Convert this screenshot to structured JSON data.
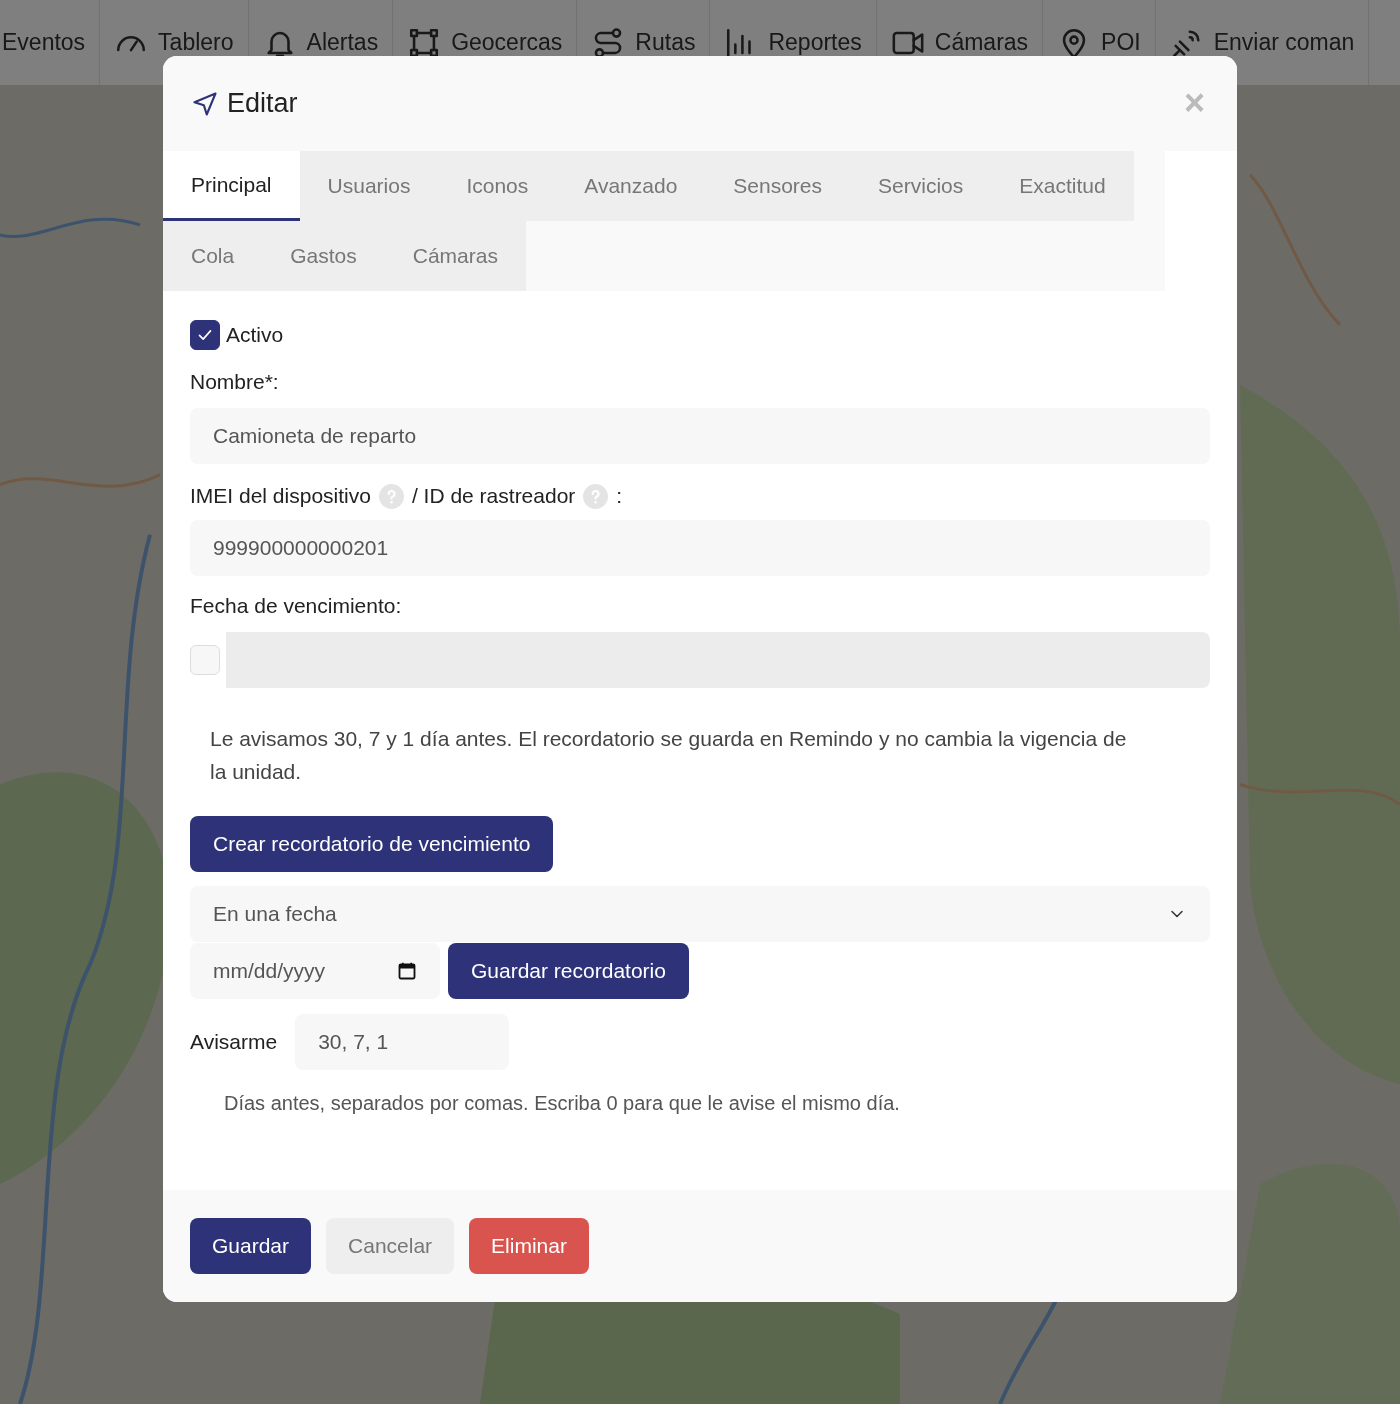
{
  "navbar": {
    "items": [
      {
        "label": "Eventos",
        "kind": "none"
      },
      {
        "label": "Tablero",
        "kind": "gauge"
      },
      {
        "label": "Alertas",
        "kind": "bell"
      },
      {
        "label": "Geocercas",
        "kind": "area"
      },
      {
        "label": "Rutas",
        "kind": "route"
      },
      {
        "label": "Reportes",
        "kind": "chart"
      },
      {
        "label": "Cámaras",
        "kind": "camera"
      },
      {
        "label": "POI",
        "kind": "pin"
      },
      {
        "label": "Enviar coman",
        "kind": "signal"
      }
    ]
  },
  "dialog": {
    "title": "Editar",
    "close": "×",
    "tabs": [
      {
        "label": "Principal",
        "selected": true
      },
      {
        "label": "Usuarios",
        "selected": false
      },
      {
        "label": "Iconos",
        "selected": false
      },
      {
        "label": "Avanzado",
        "selected": false
      },
      {
        "label": "Sensores",
        "selected": false
      },
      {
        "label": "Servicios",
        "selected": false
      },
      {
        "label": "Exactitud",
        "selected": false
      },
      {
        "label": "Cola",
        "selected": false
      },
      {
        "label": "Gastos",
        "selected": false
      },
      {
        "label": "Cámaras",
        "selected": false
      }
    ],
    "form": {
      "active": {
        "label": "Activo",
        "checked": true
      },
      "name": {
        "label": "Nombre*:",
        "value": "Camioneta de reparto"
      },
      "device": {
        "label_imei": "IMEI del dispositivo",
        "label_tracker": "/ ID de rastreador",
        "label_end": ":",
        "value": "999900000000201"
      },
      "expiry": {
        "label": "Fecha de vencimiento:",
        "checked": false,
        "disabled": true
      },
      "note": "Le avisamos 30, 7 y 1 día antes. El recordatorio se guarda en Remindo y no cambia la vigencia de la unidad.",
      "create_button": "Crear recordatorio de vencimiento",
      "reminder_type": {
        "value": "En una fecha"
      },
      "date": {
        "placeholder": "mm/dd/yyyy"
      },
      "save_reminder_button": "Guardar recordatorio",
      "notify": {
        "label": "Avisarme",
        "value": "30, 7, 1"
      },
      "hint": "Días antes, separados por comas. Escriba 0 para que le avise el mismo día."
    },
    "buttons": [
      {
        "label": "Guardar",
        "kind": "primary"
      },
      {
        "label": "Cancelar",
        "kind": "secondary"
      },
      {
        "label": "Eliminar",
        "kind": "danger"
      }
    ]
  }
}
